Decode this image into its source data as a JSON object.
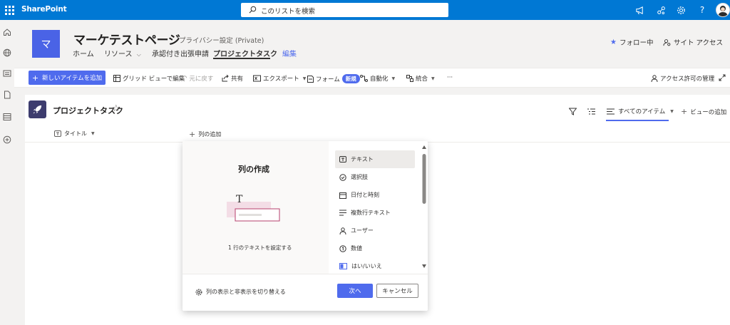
{
  "suitebar": {
    "brand": "SharePoint",
    "search_placeholder": "このリストを検索",
    "help": "?"
  },
  "site": {
    "logo_letter": "マ",
    "title": "マーケテストページ",
    "privacy": "プライバシー設定 (Private)",
    "nav": [
      {
        "label": "ホーム"
      },
      {
        "label": "リソース"
      },
      {
        "label": "承認付き出張申請"
      },
      {
        "label": "プロジェクトタスク"
      },
      {
        "label": "編集"
      }
    ],
    "follow": "フォロー中",
    "site_access": "サイト アクセス"
  },
  "commands": {
    "new_item": "新しいアイテムを追加",
    "grid_edit": "グリッド ビューで編集",
    "undo": "元に戻す",
    "share": "共有",
    "export": "エクスポート",
    "forms": "フォーム",
    "forms_badge": "新規",
    "automate": "自動化",
    "integrate": "統合",
    "more": "···",
    "manage_access": "アクセス許可の管理"
  },
  "list": {
    "title": "プロジェクトタスク",
    "view_name": "すべてのアイテム",
    "add_view": "ビューの追加",
    "columns": {
      "title": "タイトル",
      "add_column": "列の追加"
    }
  },
  "panel": {
    "heading": "列の作成",
    "preview_letter": "T",
    "preview_caption": "1 行のテキストを設定する",
    "types": [
      {
        "label": "テキスト",
        "icon": "text-icon"
      },
      {
        "label": "選択肢",
        "icon": "choice-icon"
      },
      {
        "label": "日付と時刻",
        "icon": "calendar-icon"
      },
      {
        "label": "複数行テキスト",
        "icon": "multiline-icon"
      },
      {
        "label": "ユーザー",
        "icon": "person-icon"
      },
      {
        "label": "数値",
        "icon": "number-icon"
      },
      {
        "label": "はい/いいえ",
        "icon": "yesno-icon"
      }
    ],
    "toggle_columns": "列の表示と非表示を切り替える",
    "next": "次へ",
    "cancel": "キャンセル"
  },
  "colors": {
    "suitebar": "#0078d4",
    "accent": "#4f6bed",
    "site_logo": "#4a63e6"
  }
}
